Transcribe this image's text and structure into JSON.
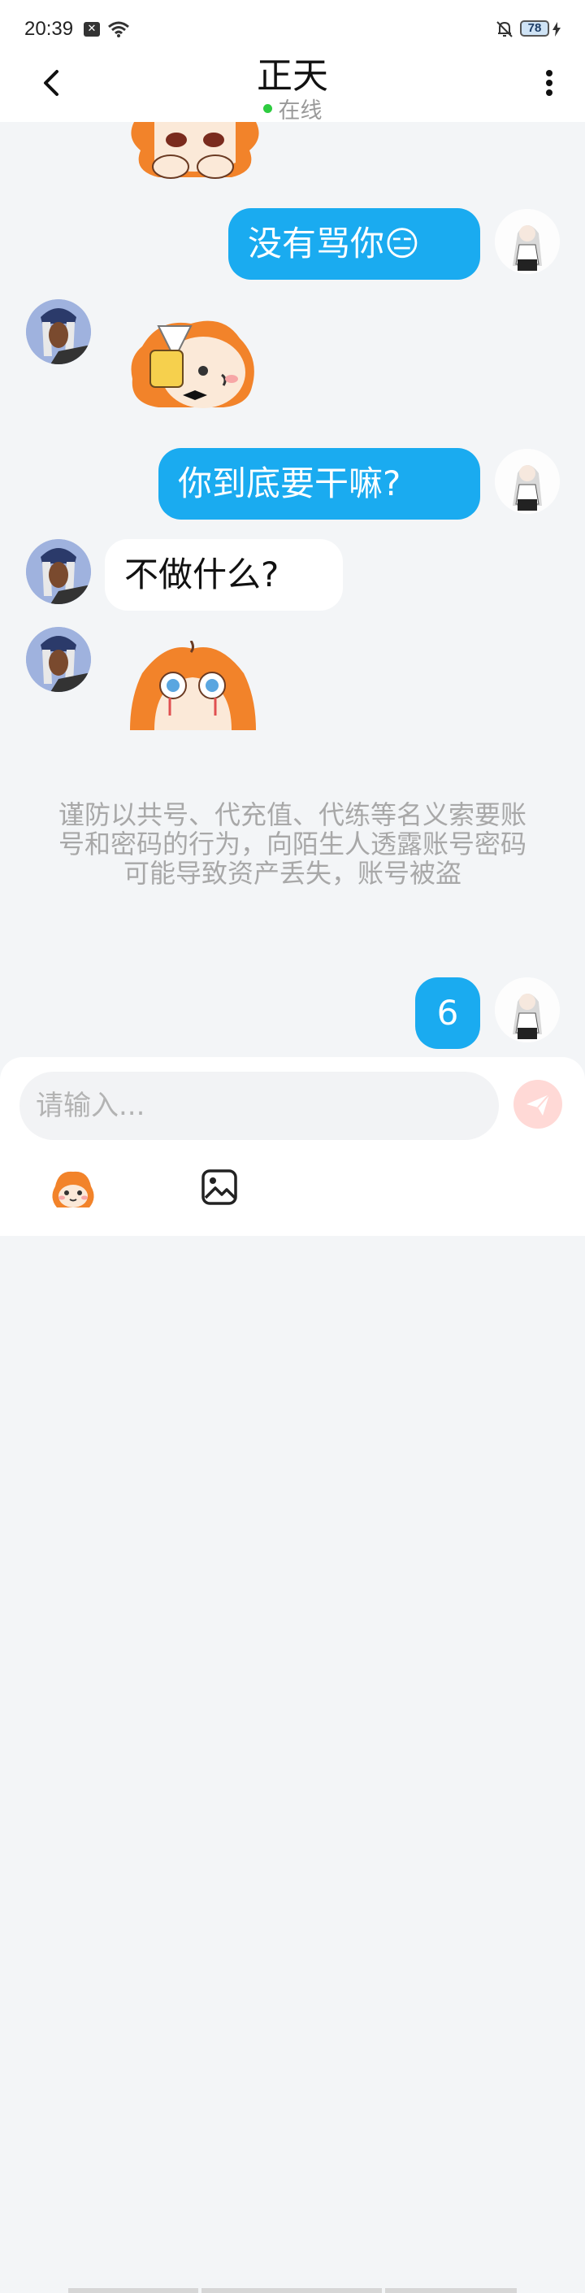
{
  "status_bar": {
    "time": "20:39",
    "battery": "78"
  },
  "header": {
    "title": "正天",
    "status": "在线"
  },
  "messages": [
    {
      "side": "out",
      "text": "没有骂你😑"
    },
    {
      "side": "out",
      "text": "你到底要干嘛?"
    },
    {
      "side": "in",
      "text": "不做什么?"
    },
    {
      "side": "out",
      "text": "6"
    }
  ],
  "notice": "谨防以共号、代充值、代练等名义索要账号和密码的行为，向陌生人透露账号密码可能导致资产丢失，账号被盗",
  "input": {
    "placeholder": "请输入..."
  },
  "colors": {
    "out_bubble": "#1aabf0",
    "online_dot": "#2ecc40",
    "send_button": "#ffd9d6"
  },
  "icons": [
    "back-arrow-icon",
    "more-vertical-icon",
    "send-icon",
    "emoji-sticker-icon",
    "image-icon",
    "wifi-icon",
    "mute-bell-icon"
  ]
}
